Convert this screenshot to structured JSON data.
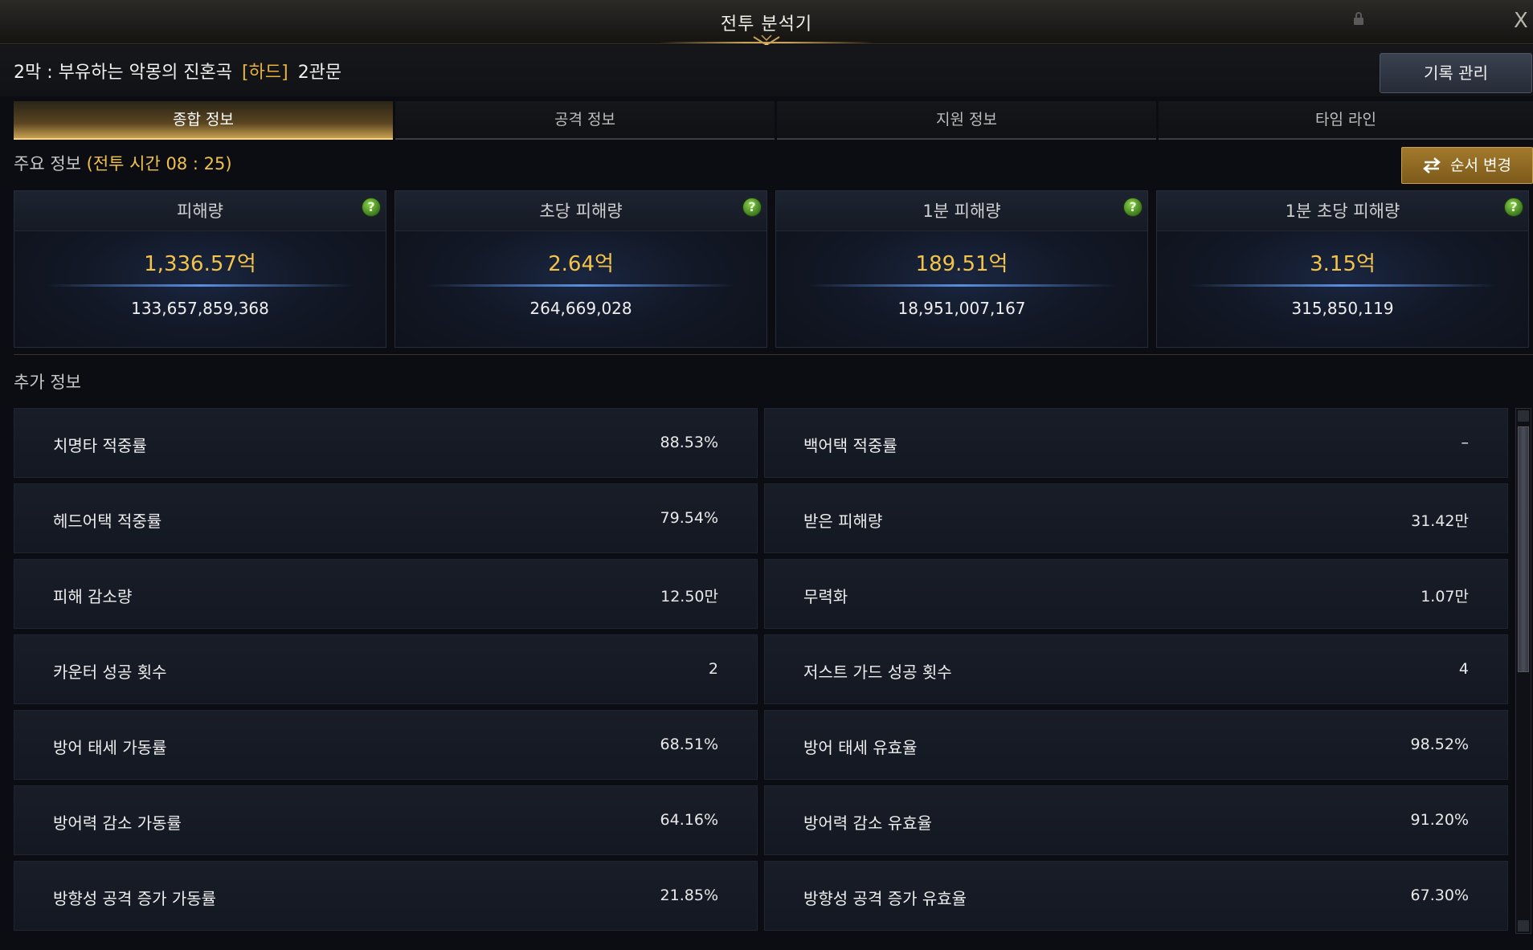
{
  "window": {
    "title": "전투 분석기",
    "close": "X"
  },
  "header": {
    "stage_name": "2막 : 부유하는 악몽의 진혼곡",
    "difficulty": "[하드]",
    "gate": "2관문",
    "record_button": "기록 관리"
  },
  "tabs": [
    {
      "label": "종합 정보",
      "active": true
    },
    {
      "label": "공격 정보",
      "active": false
    },
    {
      "label": "지원 정보",
      "active": false
    },
    {
      "label": "타임 라인",
      "active": false
    }
  ],
  "main_info": {
    "label": "주요 정보",
    "battle_time": "(전투 시간 08 : 25)",
    "order_button": "순서 변경",
    "cards": [
      {
        "title": "피해량",
        "value": "1,336.57억",
        "raw": "133,657,859,368"
      },
      {
        "title": "초당 피해량",
        "value": "2.64억",
        "raw": "264,669,028"
      },
      {
        "title": "1분 피해량",
        "value": "189.51억",
        "raw": "18,951,007,167"
      },
      {
        "title": "1분 초당 피해량",
        "value": "3.15억",
        "raw": "315,850,119"
      }
    ],
    "help_glyph": "?"
  },
  "extra_info": {
    "label": "추가 정보",
    "left": [
      {
        "label": "치명타 적중률",
        "value": "88.53%"
      },
      {
        "label": "헤드어택 적중률",
        "value": "79.54%"
      },
      {
        "label": "피해 감소량",
        "value": "12.50만"
      },
      {
        "label": "카운터 성공 횟수",
        "value": "2"
      },
      {
        "label": "방어 태세 가동률",
        "value": "68.51%"
      },
      {
        "label": "방어력 감소 가동률",
        "value": "64.16%"
      },
      {
        "label": "방향성 공격 증가 가동률",
        "value": "21.85%"
      }
    ],
    "right": [
      {
        "label": "백어택 적중률",
        "value": "–"
      },
      {
        "label": "받은 피해량",
        "value": "31.42만"
      },
      {
        "label": "무력화",
        "value": "1.07만"
      },
      {
        "label": "저스트 가드 성공 횟수",
        "value": "4"
      },
      {
        "label": "방어 태세 유효율",
        "value": "98.52%"
      },
      {
        "label": "방어력 감소 유효율",
        "value": "91.20%"
      },
      {
        "label": "방향성 공격 증가 유효율",
        "value": "67.30%"
      }
    ]
  },
  "colors": {
    "gold": "#f3c34a",
    "difficulty": "#e6b23a",
    "help_green": "#6bb536",
    "button_gold": "#a27a2c"
  },
  "icons": [
    "lock-icon",
    "close-icon",
    "help-icon",
    "swap-icon",
    "scroll-up-icon",
    "scroll-down-icon"
  ]
}
